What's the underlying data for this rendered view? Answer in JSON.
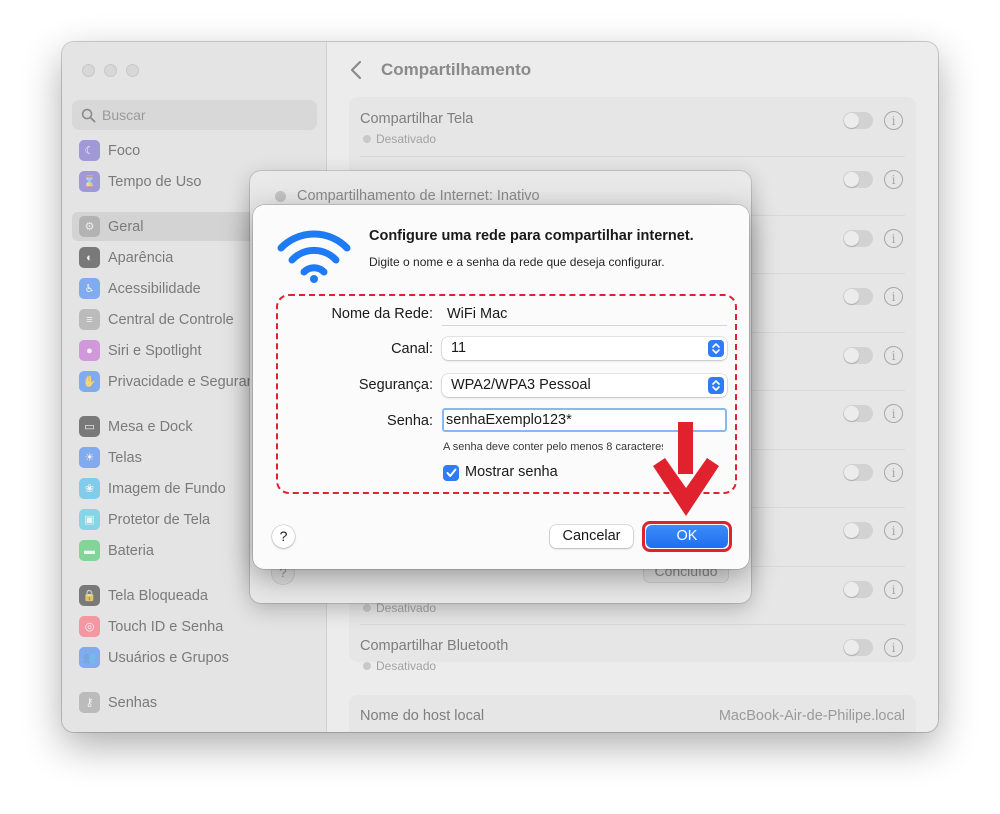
{
  "sidebar": {
    "search_placeholder": "Buscar",
    "items": [
      {
        "label": "Foco",
        "icon": "moon-icon",
        "color": "#6a5acd"
      },
      {
        "label": "Tempo de Uso",
        "icon": "hourglass-icon",
        "color": "#6a5acd"
      },
      {
        "label": "Geral",
        "icon": "gear-icon",
        "color": "#9a9a9a",
        "selected": true
      },
      {
        "label": "Aparência",
        "icon": "appearance-icon",
        "color": "#222222"
      },
      {
        "label": "Acessibilidade",
        "icon": "accessibility-icon",
        "color": "#2f7cf6"
      },
      {
        "label": "Central de Controle",
        "icon": "control-center-icon",
        "color": "#9a9a9a"
      },
      {
        "label": "Siri e Spotlight",
        "icon": "siri-icon",
        "color": "#c45ad6"
      },
      {
        "label": "Privacidade e Segurança",
        "icon": "hand-icon",
        "color": "#2f7cf6"
      },
      {
        "label": "Mesa e Dock",
        "icon": "dock-icon",
        "color": "#222222"
      },
      {
        "label": "Telas",
        "icon": "sun-icon",
        "color": "#2f7cf6"
      },
      {
        "label": "Imagem de Fundo",
        "icon": "wallpaper-icon",
        "color": "#31b8f0"
      },
      {
        "label": "Protetor de Tela",
        "icon": "screensaver-icon",
        "color": "#37c8e8"
      },
      {
        "label": "Bateria",
        "icon": "battery-icon",
        "color": "#34c759"
      },
      {
        "label": "Tela Bloqueada",
        "icon": "lock-icon",
        "color": "#222222"
      },
      {
        "label": "Touch ID e Senha",
        "icon": "fingerprint-icon",
        "color": "#ff5a6e"
      },
      {
        "label": "Usuários e Grupos",
        "icon": "users-icon",
        "color": "#2f7cf6"
      },
      {
        "label": "Senhas",
        "icon": "key-icon",
        "color": "#9a9a9a"
      }
    ]
  },
  "main": {
    "title": "Compartilhamento",
    "rows": {
      "screen_title": "Compartilhar Tela",
      "screen_status": "Desativado",
      "hidden_status": "Desativado",
      "bluetooth_title": "Compartilhar Bluetooth",
      "bluetooth_status": "Desativado",
      "host_label": "Nome do host local",
      "host_value": "MacBook-Air-de-Philipe.local"
    }
  },
  "sheet": {
    "status": "Compartilhamento de Internet: Inativo",
    "done_label": "Concluído",
    "help": "?"
  },
  "dialog": {
    "title": "Configure uma rede para compartilhar internet.",
    "subtitle": "Digite o nome e a senha da rede que deseja configurar.",
    "network_label": "Nome da Rede:",
    "network_value": "WiFi Mac",
    "channel_label": "Canal:",
    "channel_value": "11",
    "security_label": "Segurança:",
    "security_value": "WPA2/WPA3 Pessoal",
    "password_label": "Senha:",
    "password_value": "senhaExemplo123*",
    "password_hint": "A senha deve conter pelo menos 8 caracteres.",
    "show_password_label": "Mostrar senha",
    "show_password_checked": true,
    "help": "?",
    "cancel_label": "Cancelar",
    "ok_label": "OK"
  },
  "colors": {
    "accent": "#2f7cf6",
    "annotation": "#e0212e"
  }
}
